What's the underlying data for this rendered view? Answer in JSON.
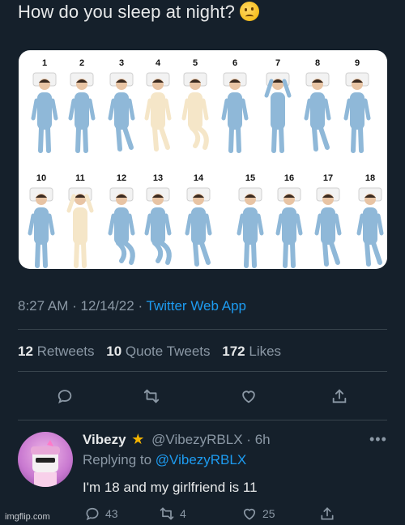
{
  "tweet": {
    "text": "How do you sleep at night?",
    "emoji_icon": "thinking-face-icon"
  },
  "media": {
    "row1_numbers": [
      "1",
      "2",
      "3",
      "4",
      "5",
      "6",
      "7",
      "8",
      "9"
    ],
    "row2_numbers": [
      "10",
      "11",
      "12",
      "13",
      "14",
      "15",
      "16",
      "17",
      "18"
    ],
    "pajama_color": "#8fb8d8",
    "highlight_color": "#f5e6c8"
  },
  "meta": {
    "time": "8:27 AM",
    "sep1": "·",
    "date": "12/14/22",
    "sep2": "·",
    "source": "Twitter Web App"
  },
  "stats": {
    "retweets_count": "12",
    "retweets_label": "Retweets",
    "quotes_count": "10",
    "quotes_label": "Quote Tweets",
    "likes_count": "172",
    "likes_label": "Likes"
  },
  "actions": [
    "reply-icon",
    "retweet-icon",
    "like-icon",
    "share-icon"
  ],
  "reply": {
    "name": "Vibezy",
    "handle": "@VibezyRBLX",
    "sep": "·",
    "age": "6h",
    "replying_prefix": "Replying to",
    "replying_to": "@VibezyRBLX",
    "text": "I'm 18 and my girlfriend is 11",
    "reply_count": "43",
    "retweet_count": "4",
    "like_count": "25"
  },
  "watermark": "imgflip.com"
}
